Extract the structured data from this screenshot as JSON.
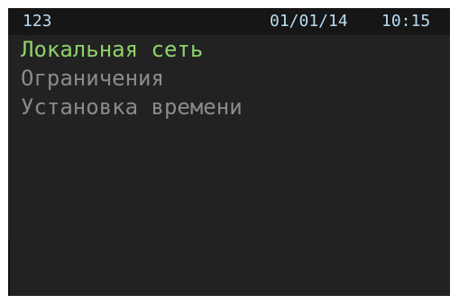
{
  "status": {
    "id": "123",
    "date": "01/01/14",
    "time": "10:15"
  },
  "menu": {
    "items": [
      {
        "label": "Локальная сеть",
        "selected": true
      },
      {
        "label": "Ограничения",
        "selected": false
      },
      {
        "label": "Установка времени",
        "selected": false
      }
    ]
  },
  "colors": {
    "background": "#222222",
    "status_text": "#b9dcf3",
    "selected_item": "#8ed16a",
    "item": "#8a8a8a"
  }
}
